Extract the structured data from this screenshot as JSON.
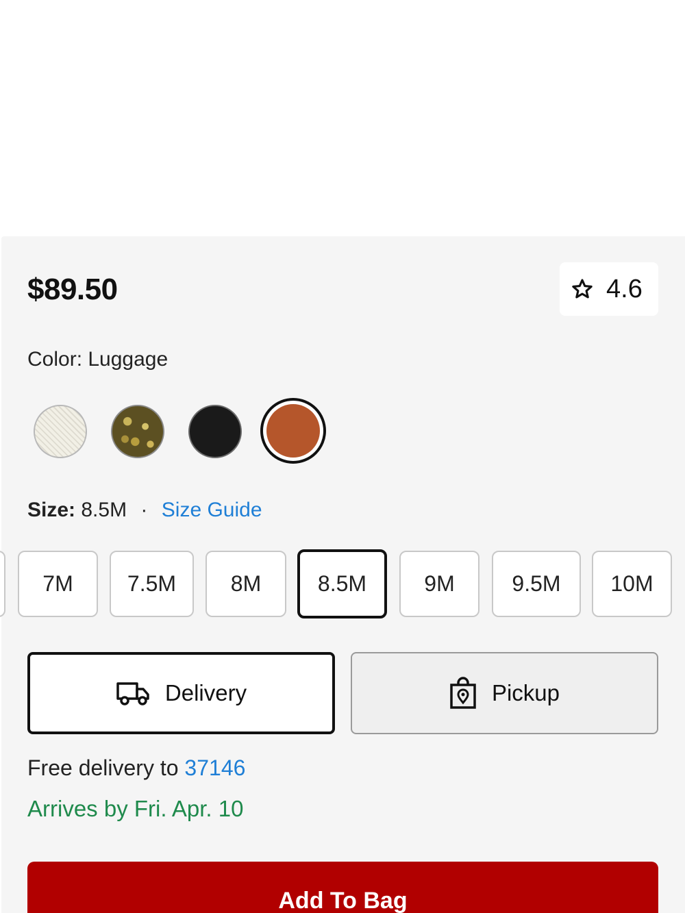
{
  "product": {
    "price": "$89.50",
    "rating": "4.6"
  },
  "color": {
    "label": "Color: Luggage",
    "swatches": [
      {
        "name": "cream",
        "selected": false
      },
      {
        "name": "gold",
        "selected": false
      },
      {
        "name": "black",
        "selected": false
      },
      {
        "name": "luggage",
        "selected": true,
        "hex": "#b5562b"
      }
    ]
  },
  "size": {
    "key": "Size:",
    "value": "8.5M",
    "separator": "·",
    "guide_label": "Size Guide",
    "options": [
      "7M",
      "7.5M",
      "8M",
      "8.5M",
      "9M",
      "9.5M",
      "10M"
    ],
    "selected": "8.5M"
  },
  "fulfillment": {
    "delivery_label": "Delivery",
    "pickup_label": "Pickup",
    "free_delivery_text": "Free delivery to",
    "zip": "37146",
    "arrives_text": "Arrives by Fri. Apr. 10"
  },
  "cta": {
    "add_to_bag": "Add To Bag"
  },
  "colors": {
    "link": "#1f7fd6",
    "success": "#1f8a4c",
    "primary": "#b10000"
  }
}
